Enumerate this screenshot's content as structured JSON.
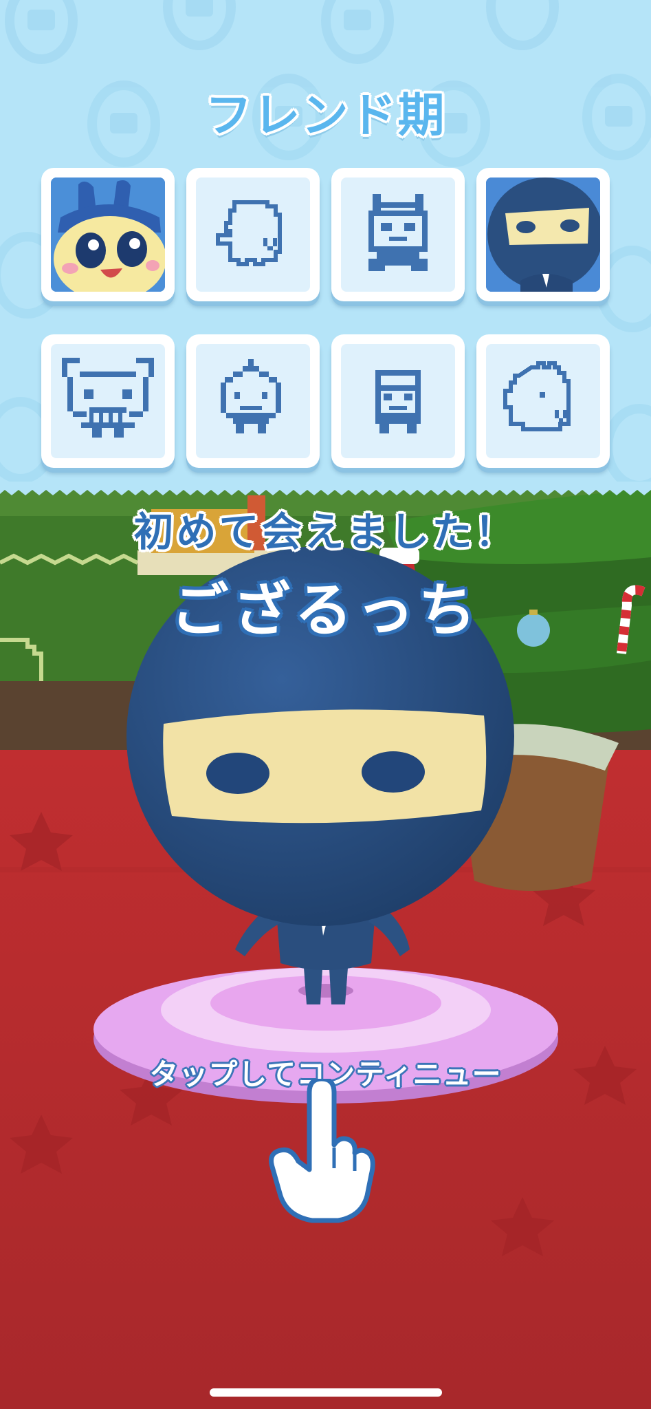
{
  "stage_title": "フレンド期",
  "characters": [
    {
      "name": "mametchi",
      "state": "discovered",
      "icon": "mametchi-portrait"
    },
    {
      "name": "unknown-1",
      "state": "silhouette",
      "icon": "pixel-ghost-icon"
    },
    {
      "name": "unknown-2",
      "state": "silhouette",
      "icon": "pixel-cat-icon"
    },
    {
      "name": "gozarutchi",
      "state": "discovered",
      "icon": "ninja-portrait"
    },
    {
      "name": "unknown-3",
      "state": "silhouette",
      "icon": "pixel-bear-icon"
    },
    {
      "name": "unknown-4",
      "state": "silhouette",
      "icon": "pixel-onion-icon"
    },
    {
      "name": "unknown-5",
      "state": "silhouette",
      "icon": "pixel-robot-icon"
    },
    {
      "name": "unknown-6",
      "state": "silhouette",
      "icon": "pixel-dino-icon"
    }
  ],
  "message": {
    "line1": "初めて会えました！",
    "character_name": "ござるっち"
  },
  "prompt": {
    "tap_label": "タップしてコンティニュー",
    "icon": "pointing-hand-icon"
  },
  "colors": {
    "sky": "#b5e4f8",
    "title_blue": "#5ab6ee",
    "text_blue": "#2f6fb6",
    "carpet_red": "#b32a2c",
    "tree_green": "#3f7a2a",
    "ninja_navy": "#2c5283",
    "platform_pink": "#e7a6f0"
  }
}
